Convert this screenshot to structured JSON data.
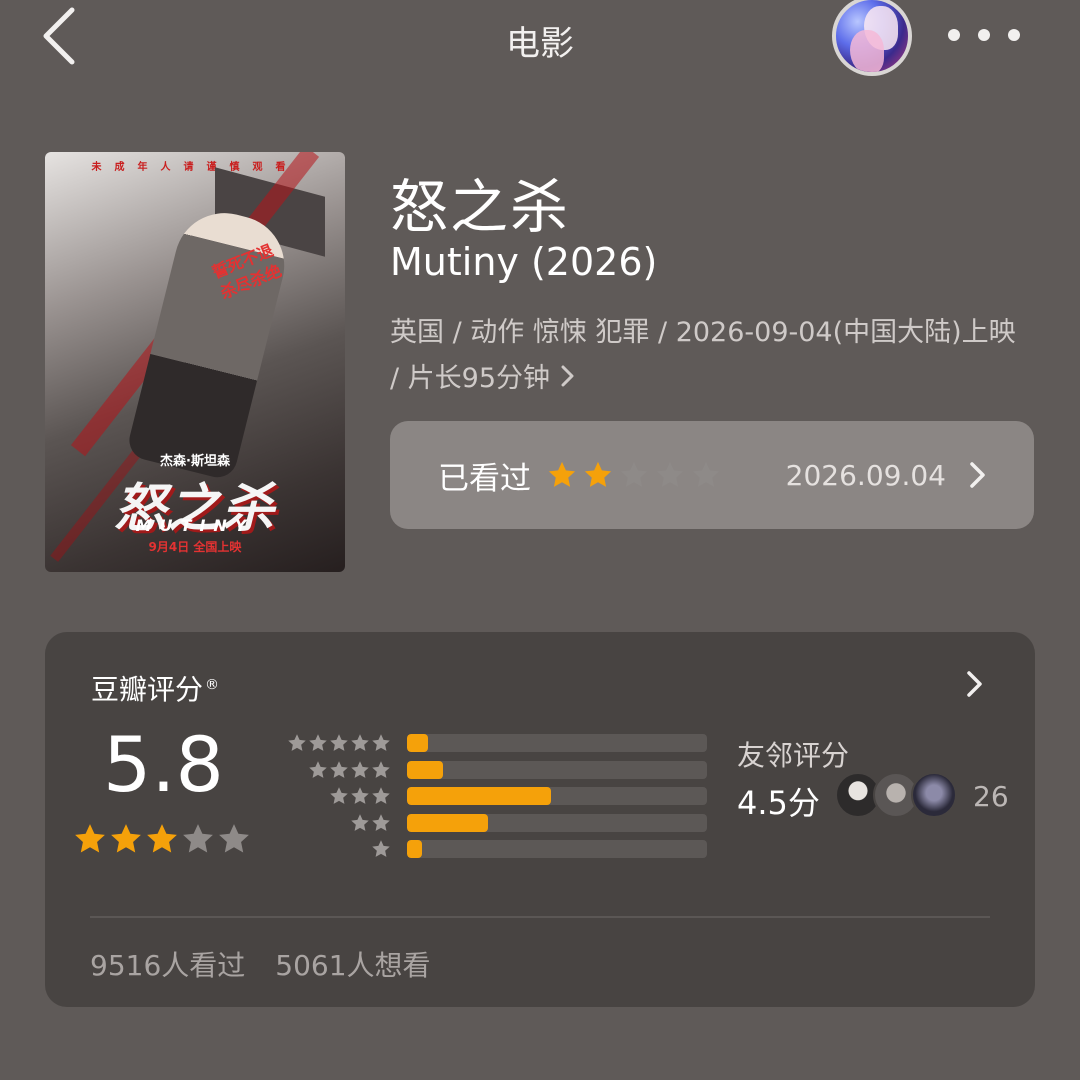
{
  "header": {
    "title": "电影",
    "back_icon": "chevron-left-icon",
    "assistant_icon": "ai-assistant-avatar",
    "more_icon": "more-horizontal-icon"
  },
  "poster": {
    "warning": "未成年人请谨慎观看",
    "tagline": [
      "誓死不退",
      "杀尽杀绝"
    ],
    "actor": "杰森·斯坦森",
    "title_cn": "怒之杀",
    "title_en": "MUTINY",
    "release": "9月4日 全国上映"
  },
  "movie": {
    "title_cn": "怒之杀",
    "title_en": "Mutiny (2026)",
    "meta": "英国 / 动作 惊悚 犯罪 / 2026-09-04(中国大陆)上映 / 片长95分钟"
  },
  "watched": {
    "label": "已看过",
    "rating_stars": 2,
    "max_stars": 5,
    "date": "2026.09.04"
  },
  "rating": {
    "title": "豆瓣评分",
    "registered_mark": "®",
    "score": "5.8",
    "score_stars": 3,
    "distribution": [
      {
        "stars": 5,
        "fraction": 0.07
      },
      {
        "stars": 4,
        "fraction": 0.12
      },
      {
        "stars": 3,
        "fraction": 0.48
      },
      {
        "stars": 2,
        "fraction": 0.27
      },
      {
        "stars": 1,
        "fraction": 0.05
      }
    ],
    "friends_label": "友邻评分",
    "friends_score": "4.5分",
    "friends_count": "26",
    "watched_count": "9516人看过",
    "wish_count": "5061人想看"
  },
  "colors": {
    "background": "#5f5a58",
    "card": "#484442",
    "star_active": "#f5a10a",
    "star_inactive": "#8e8a88"
  }
}
